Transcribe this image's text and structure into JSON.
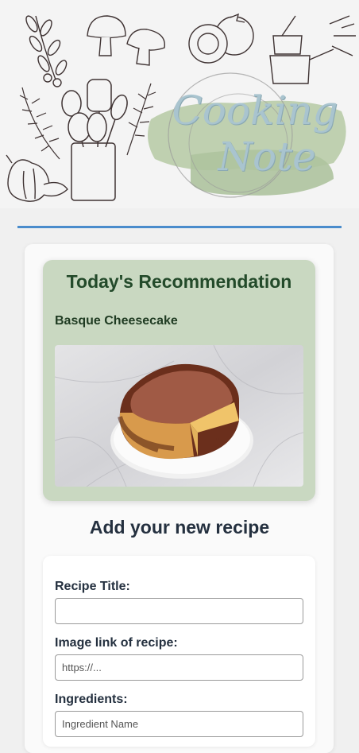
{
  "app": {
    "logo_line1": "Cooking",
    "logo_line2": "Note"
  },
  "recommendation": {
    "title": "Today's Recommendation",
    "recipe_name": "Basque Cheesecake",
    "image_icon": "cheesecake-photo"
  },
  "add_recipe": {
    "title": "Add your new recipe",
    "fields": [
      {
        "label": "Recipe Title:",
        "value": "",
        "placeholder": ""
      },
      {
        "label": "Image link of recipe:",
        "value": "",
        "placeholder": "https://..."
      },
      {
        "label": "Ingredients:",
        "value": "",
        "placeholder": "Ingredient Name"
      }
    ]
  },
  "colors": {
    "accent_blue": "#4a8ccc",
    "recommendation_bg": "#c9d8c1",
    "recommendation_text": "#234a2a",
    "logo_text": "#a9c4cf"
  }
}
